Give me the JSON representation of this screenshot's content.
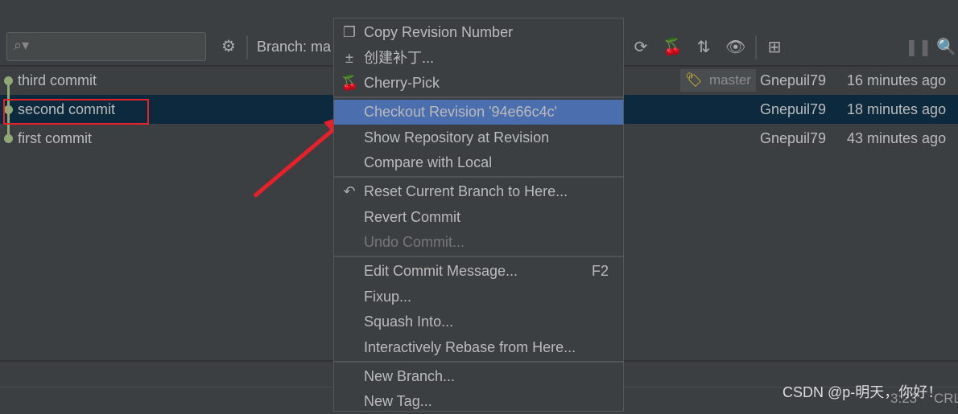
{
  "toolbar": {
    "branch_label": "Branch: ma",
    "search_placeholder": ""
  },
  "commits": [
    {
      "subject": "third commit",
      "author": "Gnepuil79",
      "date": "16 minutes ago",
      "tag": "master",
      "selected": false
    },
    {
      "subject": "second commit",
      "author": "Gnepuil79",
      "date": "18 minutes ago",
      "selected": true
    },
    {
      "subject": "first commit",
      "author": "Gnepuil79",
      "date": "43 minutes ago",
      "selected": false
    }
  ],
  "menu": {
    "items": [
      {
        "label": "Copy Revision Number",
        "icon": "copy-icon"
      },
      {
        "label": "创建补丁...",
        "icon": "patch-icon"
      },
      {
        "label": "Cherry-Pick",
        "icon": "cherry-icon"
      },
      {
        "label": "Checkout Revision '94e66c4c'"
      },
      {
        "label": "Show Repository at Revision"
      },
      {
        "label": "Compare with Local"
      },
      {
        "label": "Reset Current Branch to Here...",
        "icon": "undo-icon"
      },
      {
        "label": "Revert Commit"
      },
      {
        "label": "Undo Commit...",
        "disabled": true
      },
      {
        "label": "Edit Commit Message...",
        "shortcut": "F2"
      },
      {
        "label": "Fixup..."
      },
      {
        "label": "Squash Into..."
      },
      {
        "label": "Interactively Rebase from Here..."
      },
      {
        "label": "New Branch..."
      },
      {
        "label": "New Tag..."
      }
    ]
  },
  "watermark": "CSDN @p-明天，你好！",
  "status": {
    "position": "3:23",
    "line_ending": "CRL"
  },
  "colors": {
    "selection": "#0d293e",
    "menu_highlight": "#4b6eaf",
    "graph": "#8fa876",
    "annotation": "#e8202a"
  }
}
